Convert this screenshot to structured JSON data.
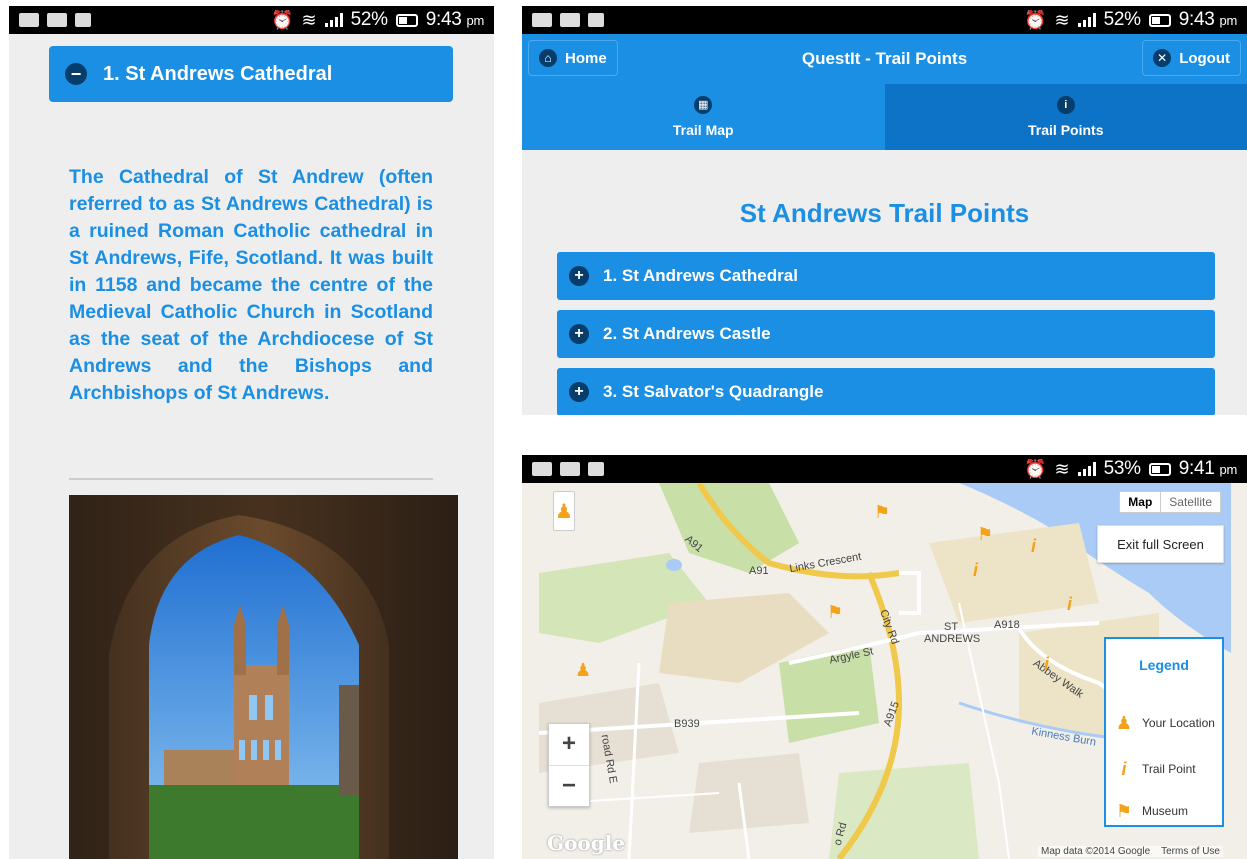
{
  "panel1": {
    "status": {
      "battery": "52%",
      "time": "9:43",
      "ampm": "pm"
    },
    "header": {
      "title": "1. St Andrews Cathedral",
      "toggle_icon": "minus-circle-icon"
    },
    "description": "The Cathedral of St Andrew (often referred to as St Andrews Cathedral) is a ruined Roman Catholic cathedral in St Andrews, Fife, Scotland. It was built in 1158 and became the centre of the Medieval Catholic Church in Scotland as the seat of the Archdiocese of St Andrews and the Bishops and Archbishops of St Andrews."
  },
  "panel2": {
    "status": {
      "battery": "52%",
      "time": "9:43",
      "ampm": "pm"
    },
    "header": {
      "home_label": "Home",
      "title": "QuestIt - Trail Points",
      "logout_label": "Logout"
    },
    "tabs": [
      {
        "label": "Trail Map",
        "icon": "grid-icon"
      },
      {
        "label": "Trail Points",
        "icon": "info-icon"
      }
    ],
    "page_title": "St Andrews Trail Points",
    "trail_items": [
      {
        "label": "1. St Andrews Cathedral"
      },
      {
        "label": "2. St Andrews Castle"
      },
      {
        "label": "3. St Salvator's Quadrangle"
      }
    ]
  },
  "panel3": {
    "status": {
      "battery": "53%",
      "time": "9:41",
      "ampm": "pm"
    },
    "map_toggle": {
      "map": "Map",
      "satellite": "Satellite"
    },
    "exit_full_screen": "Exit full Screen",
    "zoom": {
      "in": "+",
      "out": "−"
    },
    "legend": {
      "title": "Legend",
      "items": [
        {
          "label": "Your Location",
          "icon": "person-icon"
        },
        {
          "label": "Trail Point",
          "icon": "info-marker-icon"
        },
        {
          "label": "Museum",
          "icon": "flag-icon"
        }
      ]
    },
    "map_labels": {
      "a91_1": "A91",
      "a91_2": "A91",
      "links_crescent": "Links Crescent",
      "city_rd": "City Rd",
      "st_andrews_1": "ST",
      "st_andrews_2": "ANDREWS",
      "a918": "A918",
      "argyle_st": "Argyle St",
      "abbey_walk": "Abbey Walk",
      "b939": "B939",
      "a915": "A915",
      "kinness_burn": "Kinness Burn",
      "road_rd_e": "road Rd E",
      "rd_bottom": "o Rd"
    },
    "attribution": {
      "data": "Map data ©2014 Google",
      "terms": "Terms of Use"
    },
    "google_logo": "Google"
  }
}
